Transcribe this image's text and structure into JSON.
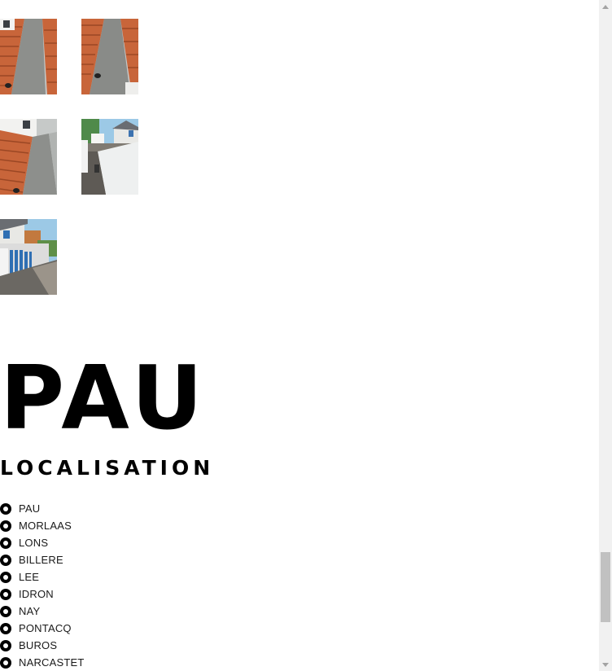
{
  "gallery": {
    "images": [
      {
        "name": "roof-gutter-photo-1",
        "scene": "roof"
      },
      {
        "name": "roof-gutter-photo-2",
        "scene": "roof-angled"
      },
      {
        "name": "roof-gutter-photo-3",
        "scene": "roof"
      },
      {
        "name": "house-walkway-photo-1",
        "scene": "street"
      },
      {
        "name": "house-walkway-photo-2",
        "scene": "street-gate"
      }
    ]
  },
  "city": {
    "title": "PAU"
  },
  "localisation": {
    "heading": "LOCALISATION",
    "bullet_icon": "circle-bullet-icon",
    "towns": [
      "PAU",
      "MORLAAS",
      "LONS",
      "BILLERE",
      "LEE",
      "IDRON",
      "NAY",
      "PONTACQ",
      "BUROS",
      "NARCASTET"
    ]
  },
  "scrollbar": {
    "position_fraction": 0.94
  },
  "colors": {
    "background": "#ffffff",
    "text": "#000000",
    "roof_tile": "#c8653a",
    "gutter_grey": "#8d8f8c",
    "sky": "#9cc9e6",
    "gate_blue": "#2f6fb3"
  }
}
